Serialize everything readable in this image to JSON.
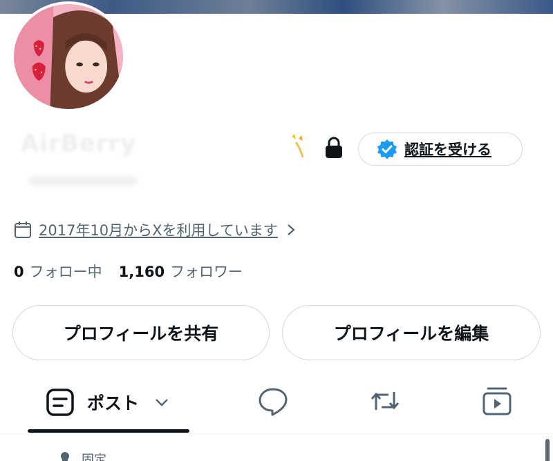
{
  "profile": {
    "display_name": "AirBerry",
    "verify_button_label": "認証を受ける",
    "joined_text": "2017年10月からXを利用しています",
    "following_count": "0",
    "following_label": "フォロー中",
    "followers_count": "1,160",
    "followers_label": "フォロワー"
  },
  "actions": {
    "share_label": "プロフィールを共有",
    "edit_label": "プロフィールを編集"
  },
  "tabs": {
    "posts_label": "ポスト",
    "icons": [
      "posts-icon",
      "replies-icon",
      "reposts-icon",
      "media-icon"
    ]
  },
  "pinned": {
    "label": "固定"
  },
  "colors": {
    "text_primary": "#0f1419",
    "text_secondary": "#536471",
    "border": "#cfd9de",
    "verified_blue": "#1d9bf0"
  }
}
